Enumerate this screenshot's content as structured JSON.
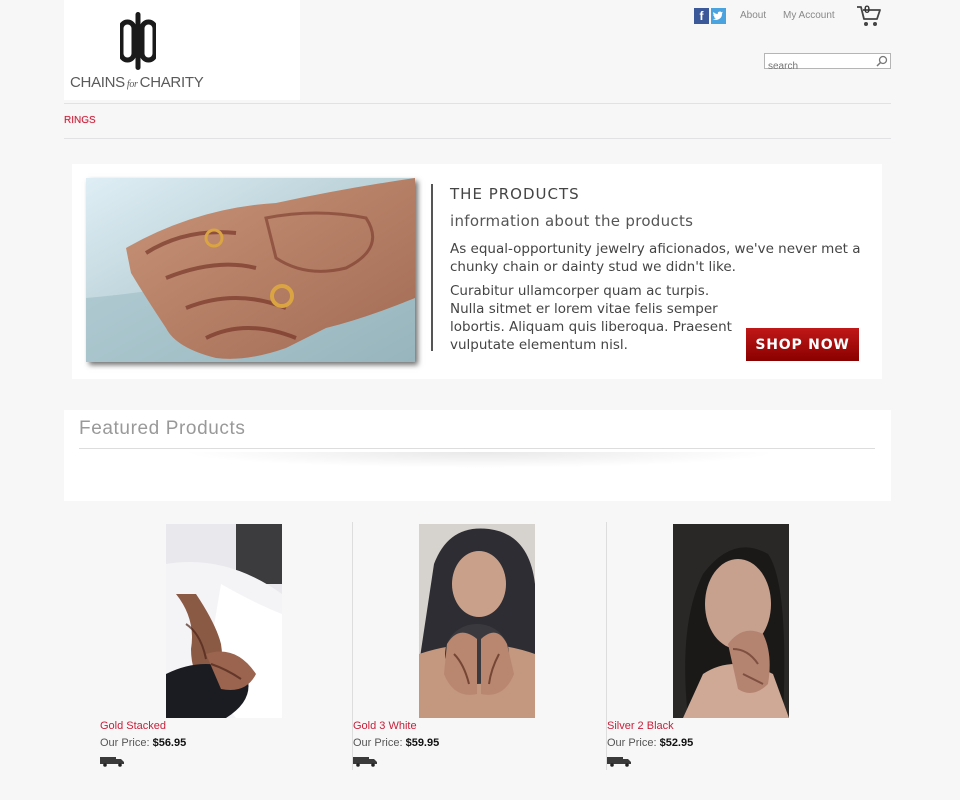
{
  "brand": {
    "logo_text_1": "CHAINS",
    "logo_text_for": "for",
    "logo_text_2": "CHARITY"
  },
  "header": {
    "social": {
      "facebook_letter": "f"
    },
    "links": [
      "About",
      "My Account"
    ],
    "cart_count": "0",
    "search_placeholder": "search"
  },
  "nav": {
    "items": [
      "RINGS"
    ]
  },
  "hero": {
    "title": "THE PRODUCTS",
    "subtitle": "information about the products",
    "para1": "As equal-opportunity jewelry aficionados, we've never met a chunky chain or dainty stud we didn't like.",
    "para2": "Curabitur ullamcorper quam ac turpis. Nulla sitmet er lorem vitae felis semper lobortis. Aliquam quis liberoqua. Praesent vulputate elementum nisl.",
    "cta": "SHOP NOW"
  },
  "featured": {
    "title": "Featured Products"
  },
  "products": [
    {
      "name": "Gold Stacked",
      "price_label": "Our Price:",
      "price": "$56.95"
    },
    {
      "name": "Gold 3 White",
      "price_label": "Our Price:",
      "price": "$59.95"
    },
    {
      "name": "Silver 2 Black",
      "price_label": "Our Price:",
      "price": "$52.95"
    }
  ],
  "colors": {
    "accent": "#c8203a",
    "cta": "#a40c0c",
    "facebook": "#3b5998",
    "twitter": "#4aa3df"
  }
}
